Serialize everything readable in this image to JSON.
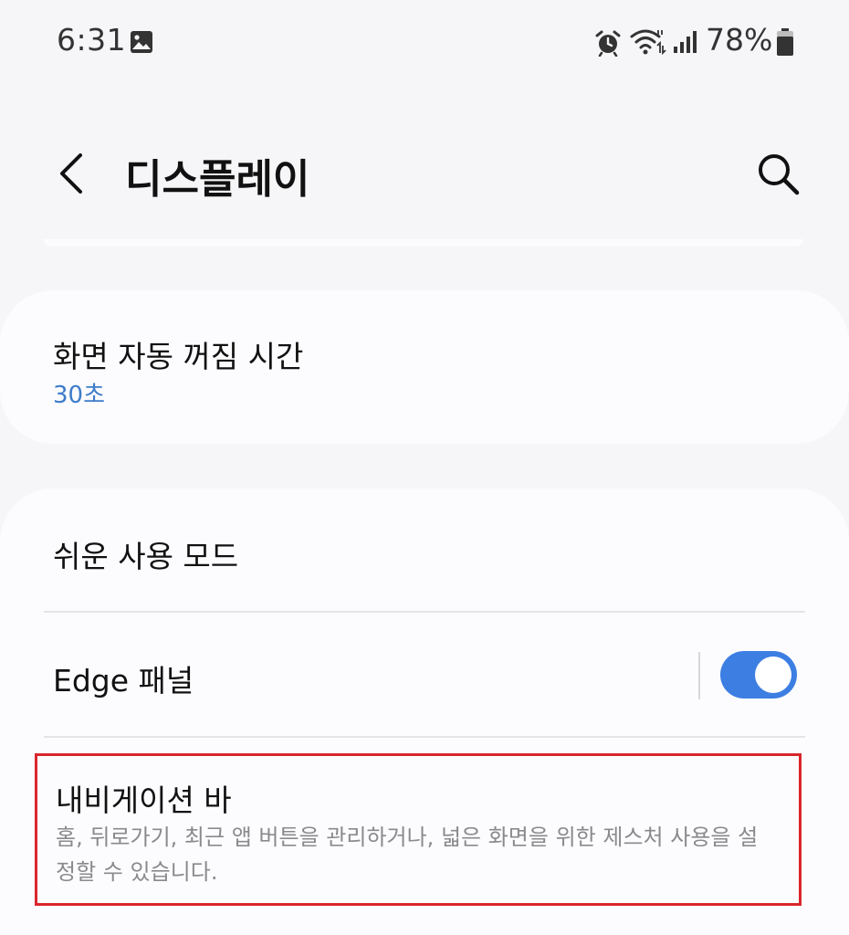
{
  "status_bar": {
    "time": "6:31",
    "battery": "78%",
    "icons": [
      "gallery-icon",
      "alarm-icon",
      "wifi-icon",
      "signal-icon",
      "battery-icon"
    ]
  },
  "header": {
    "title": "디스플레이",
    "back_icon": "chevron-left-icon",
    "search_icon": "search-icon"
  },
  "settings": {
    "screen_timeout": {
      "title": "화면 자동 꺼짐 시간",
      "value": "30초"
    },
    "easy_mode": {
      "title": "쉬운 사용 모드"
    },
    "edge_panels": {
      "title": "Edge 패널",
      "enabled": true
    },
    "navigation_bar": {
      "title": "내비게이션 바",
      "description": "홈, 뒤로가기, 최근 앱 버튼을 관리하거나, 넓은 화면을 위한 제스처 사용을 설정할 수 있습니다."
    }
  },
  "colors": {
    "background": "#f6f6f8",
    "card": "#fcfcfe",
    "accent": "#3d7ee3",
    "sub_text": "#3d7cc9",
    "description_text": "#8a8a8e",
    "highlight_border": "#d9262c"
  }
}
